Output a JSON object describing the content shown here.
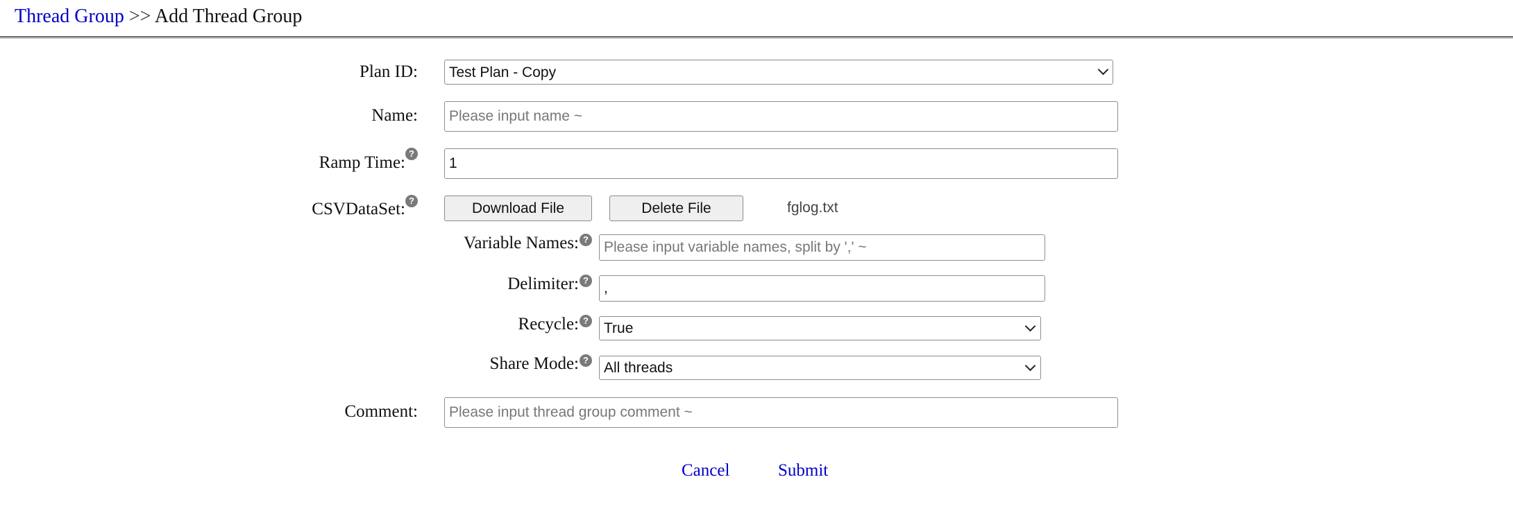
{
  "breadcrumb": {
    "parent": "Thread Group",
    "separator": ">>",
    "current": "Add Thread Group"
  },
  "form": {
    "plan_id": {
      "label": "Plan ID:",
      "selected": "Test Plan - Copy"
    },
    "name": {
      "label": "Name:",
      "value": "",
      "placeholder": "Please input name ~"
    },
    "ramp_time": {
      "label": "Ramp Time:",
      "value": "1",
      "help": "?"
    },
    "csv_dataset": {
      "label": "CSVDataSet:",
      "help": "?",
      "download_label": "Download File",
      "delete_label": "Delete File",
      "file_name": "fglog.txt",
      "variable_names": {
        "label": "Variable Names:",
        "help": "?",
        "value": "",
        "placeholder": "Please input variable names, split by ',' ~"
      },
      "delimiter": {
        "label": "Delimiter:",
        "help": "?",
        "value": ","
      },
      "recycle": {
        "label": "Recycle:",
        "help": "?",
        "selected": "True"
      },
      "share_mode": {
        "label": "Share Mode:",
        "help": "?",
        "selected": "All threads"
      }
    },
    "comment": {
      "label": "Comment:",
      "value": "",
      "placeholder": "Please input thread group comment ~"
    }
  },
  "actions": {
    "cancel_label": "Cancel",
    "submit_label": "Submit"
  },
  "colors": {
    "link": "#0000cc",
    "help_icon": "#7a7a7a",
    "button_bg": "#efefef",
    "field_border": "#8d8d8d"
  }
}
